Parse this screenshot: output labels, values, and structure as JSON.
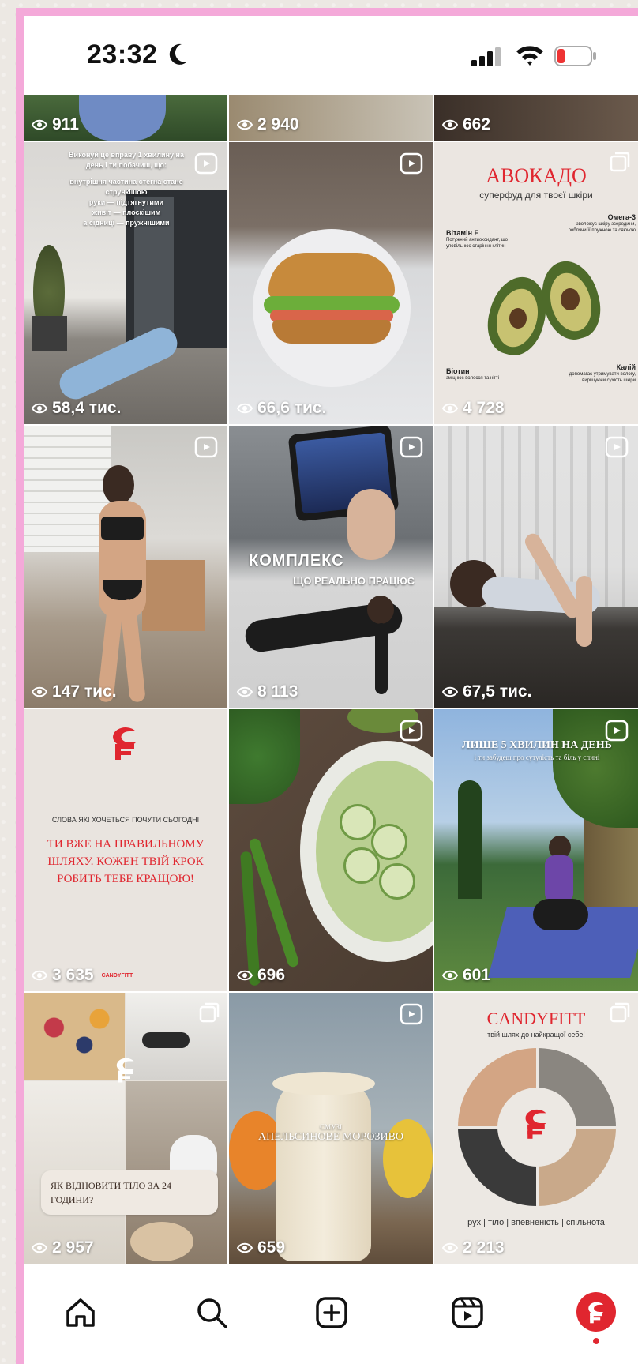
{
  "status_bar": {
    "time": "23:32"
  },
  "grid": {
    "top_row": [
      {
        "views": "911"
      },
      {
        "views": "2 940"
      },
      {
        "views": "662"
      }
    ],
    "posts": [
      {
        "views": "58,4 тис.",
        "overlay_lines": [
          "Виконуй це вправу 1 хвилину на",
          "день і ти побачиш, що:",
          "внутрішня частина стегна стане",
          "стрункішою",
          "руки — підтягнутими",
          "живіт — плоскішим",
          "а сідниці — пружнішими"
        ]
      },
      {
        "views": "66,6 тис."
      },
      {
        "views": "4 728",
        "title": "АВОКАДО",
        "subtitle": "суперфуд для твоєї шкіри",
        "labels": [
          {
            "name": "Вітамін Е",
            "desc": "Потужний антиоксидант, що уповільнює старіння клітин"
          },
          {
            "name": "Омега-3",
            "desc": "зволожує шкіру зсередини, роблячи її пружною та сяючою"
          },
          {
            "name": "Біотин",
            "desc": "зміцнює волосся та нігті"
          },
          {
            "name": "Калій",
            "desc": "допомагає утримувати вологу, вирішуючи сухість шкіри"
          }
        ]
      },
      {
        "views": "147 тис."
      },
      {
        "views": "8 113",
        "overlay_lines": [
          "КОМПЛЕКС",
          "ЩО РЕАЛЬНО ПРАЦЮЄ"
        ]
      },
      {
        "views": "67,5 тис."
      },
      {
        "views": "3 635",
        "kicker": "СЛОВА ЯКІ ХОЧЕТЬСЯ ПОЧУТИ СЬОГОДНІ",
        "quote": "ТИ ВЖЕ НА ПРАВИЛЬНОМУ ШЛЯХУ. КОЖЕН ТВІЙ КРОК РОБИТЬ ТЕБЕ КРАЩОЮ!",
        "footer_brand": "CANDYFITT"
      },
      {
        "views": "696"
      },
      {
        "views": "601",
        "overlay_lines": [
          "ЛИШЕ 5 ХВИЛИН НА ДЕНЬ",
          "і ти забудеш про сутулість та біль у спині"
        ]
      },
      {
        "views": "2 957",
        "caption": "ЯК ВІДНОВИТИ ТІЛО ЗА 24 ГОДИНИ?"
      },
      {
        "views": "659",
        "overlay_lines": [
          "СМУЗІ",
          "АПЕЛЬСИНОВЕ МОРОЗИВО"
        ]
      },
      {
        "views": "2 213",
        "title": "CANDYFITT",
        "subtitle": "твій шлях до найкращої себе!",
        "footer": "рух | тіло | впевненість | спільнота"
      }
    ]
  },
  "colors": {
    "brand_red": "#e0262f",
    "frame_pink": "#f4a9d9"
  }
}
